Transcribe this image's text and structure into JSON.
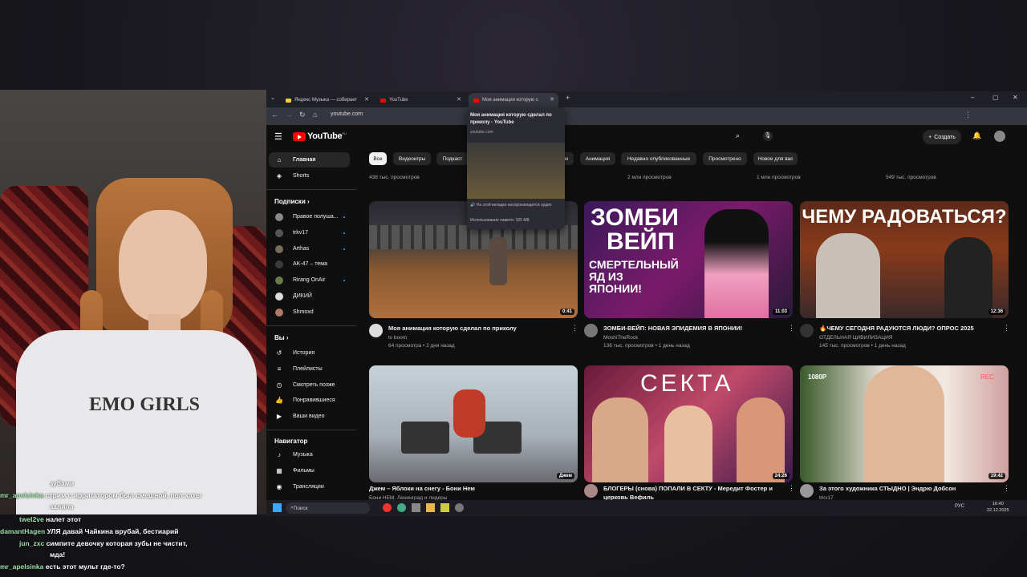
{
  "browser": {
    "tabs": [
      {
        "label": "Яндекс Музыка — собирает"
      },
      {
        "label": "YouTube"
      },
      {
        "label": "Моя анимация которую с"
      }
    ],
    "url": "youtube.com",
    "tab_preview": {
      "title": "Моя анимация которую сделал по приколу - YouTube",
      "domain": "youtube.com",
      "audio_note": "На этой вкладке воспроизводится аудио",
      "memory": "Использование памяти: 325 МБ"
    }
  },
  "youtube": {
    "logo_text": "YouTube",
    "logo_region": "RU",
    "create_label": "Создать",
    "sidebar": {
      "main": [
        {
          "label": "Главная",
          "icon": "home-icon"
        },
        {
          "label": "Shorts",
          "icon": "shorts-icon"
        }
      ],
      "subscriptions_header": "Подписки",
      "subscriptions": [
        {
          "label": "Правое полуша...",
          "color": "#8a8a8a"
        },
        {
          "label": "trkv17",
          "color": "#555555"
        },
        {
          "label": "Arthas",
          "color": "#7a6a5a"
        },
        {
          "label": "AK-47 – тема",
          "color": "#3a3a3a"
        },
        {
          "label": "Rirang OnAir",
          "color": "#6a7a4a"
        },
        {
          "label": "ДИКИЙ",
          "color": "#dddddd"
        },
        {
          "label": "Shmoxd",
          "color": "#b07a6a"
        }
      ],
      "you_header": "Вы",
      "you": [
        {
          "label": "История",
          "icon": "history-icon"
        },
        {
          "label": "Плейлисты",
          "icon": "playlists-icon"
        },
        {
          "label": "Смотреть позже",
          "icon": "watch-later-icon"
        },
        {
          "label": "Понравившиеся",
          "icon": "like-icon"
        },
        {
          "label": "Ваши видео",
          "icon": "your-videos-icon"
        }
      ],
      "navigator_header": "Навигатор",
      "navigator": [
        {
          "label": "Музыка",
          "icon": "music-icon"
        },
        {
          "label": "Фильмы",
          "icon": "movies-icon"
        },
        {
          "label": "Трансляции",
          "icon": "live-icon"
        }
      ]
    },
    "chips": [
      "Все",
      "Видеоигры",
      "Подкаст",
      "м",
      "Анимация",
      "Недавно опубликованные",
      "Просмотрено",
      "Новое для вас"
    ],
    "top_views": [
      "438 тыс. просмотров",
      "2 млн просмотров",
      "1 млн просмотров",
      "549 тыс. просмотров"
    ],
    "videos": [
      {
        "title": "Моя анимация которую сделал по приколу",
        "channel": "tv boom",
        "meta": "64 просмотра • 2 дня назад",
        "duration": "0:41"
      },
      {
        "title": "ЗОМБИ-ВЕЙП: НОВАЯ ЭПИДЕМИЯ В ЯПОНИИ!",
        "channel": "MoshiTheRock",
        "meta": "136 тыс. просмотров • 1 день назад",
        "duration": "11:03",
        "thumb_text1": "ЗОМБИ",
        "thumb_text2": "ВЕЙП",
        "thumb_text3": "СМЕРТЕЛЬНЫЙ ЯД ИЗ ЯПОНИИ!"
      },
      {
        "title": "🔥ЧЕМУ СЕГОДНЯ РАДУЮТСЯ ЛЮДИ? ОПРОС 2025",
        "channel": "ОТДЕЛЬНАЯ ЦИВИЛИЗАЦИЯ",
        "meta": "145 тыс. просмотров • 1 день назад",
        "duration": "12:36",
        "thumb_text1": "ЧЕМУ РАДОВАТЬСЯ?"
      },
      {
        "title": "Джем – Яблоки на снегу - Бони Нем",
        "channel": "Бони НЕМ. Ленинград и лидеры",
        "meta": "",
        "duration": "Джем"
      },
      {
        "title": "БЛОГЕРЫ (снова) ПОПАЛИ В СЕКТУ - Мередит Фостер и церковь Вефиль",
        "channel": "",
        "meta": "",
        "duration": "24:26",
        "thumb_text1": "СЕКТА"
      },
      {
        "title": "За этого художника СТЫДНО | Эндрю Добсон",
        "channel": "trkv17",
        "meta": "",
        "duration": "19:42",
        "thumb_text1": "1080P",
        "thumb_text2": "REC"
      }
    ]
  },
  "taskbar": {
    "search_placeholder": "Поиск",
    "lang": "РУС",
    "time": "16:40",
    "date": "22.12.2025"
  },
  "chat": [
    {
      "user": "",
      "text": "зубами"
    },
    {
      "user": "mr_apelsinka",
      "text": "стрим с ирригатором был смешной, пол хаты"
    },
    {
      "user": "",
      "text": "залила"
    },
    {
      "user": "twel2ve",
      "text": "налет этот"
    },
    {
      "user": "damantHagen",
      "text": "УЛЯ давай Чайкина врубай, бестиарий"
    },
    {
      "user": "jun_zxc",
      "text": "симпите девочку которая зубы не чистит,"
    },
    {
      "user": "",
      "text": "мда!"
    },
    {
      "user": "mr_apelsinka",
      "text": "есть этот мульт где-то?"
    }
  ],
  "webcam": {
    "shirt_text": "EMO GIRLS"
  }
}
